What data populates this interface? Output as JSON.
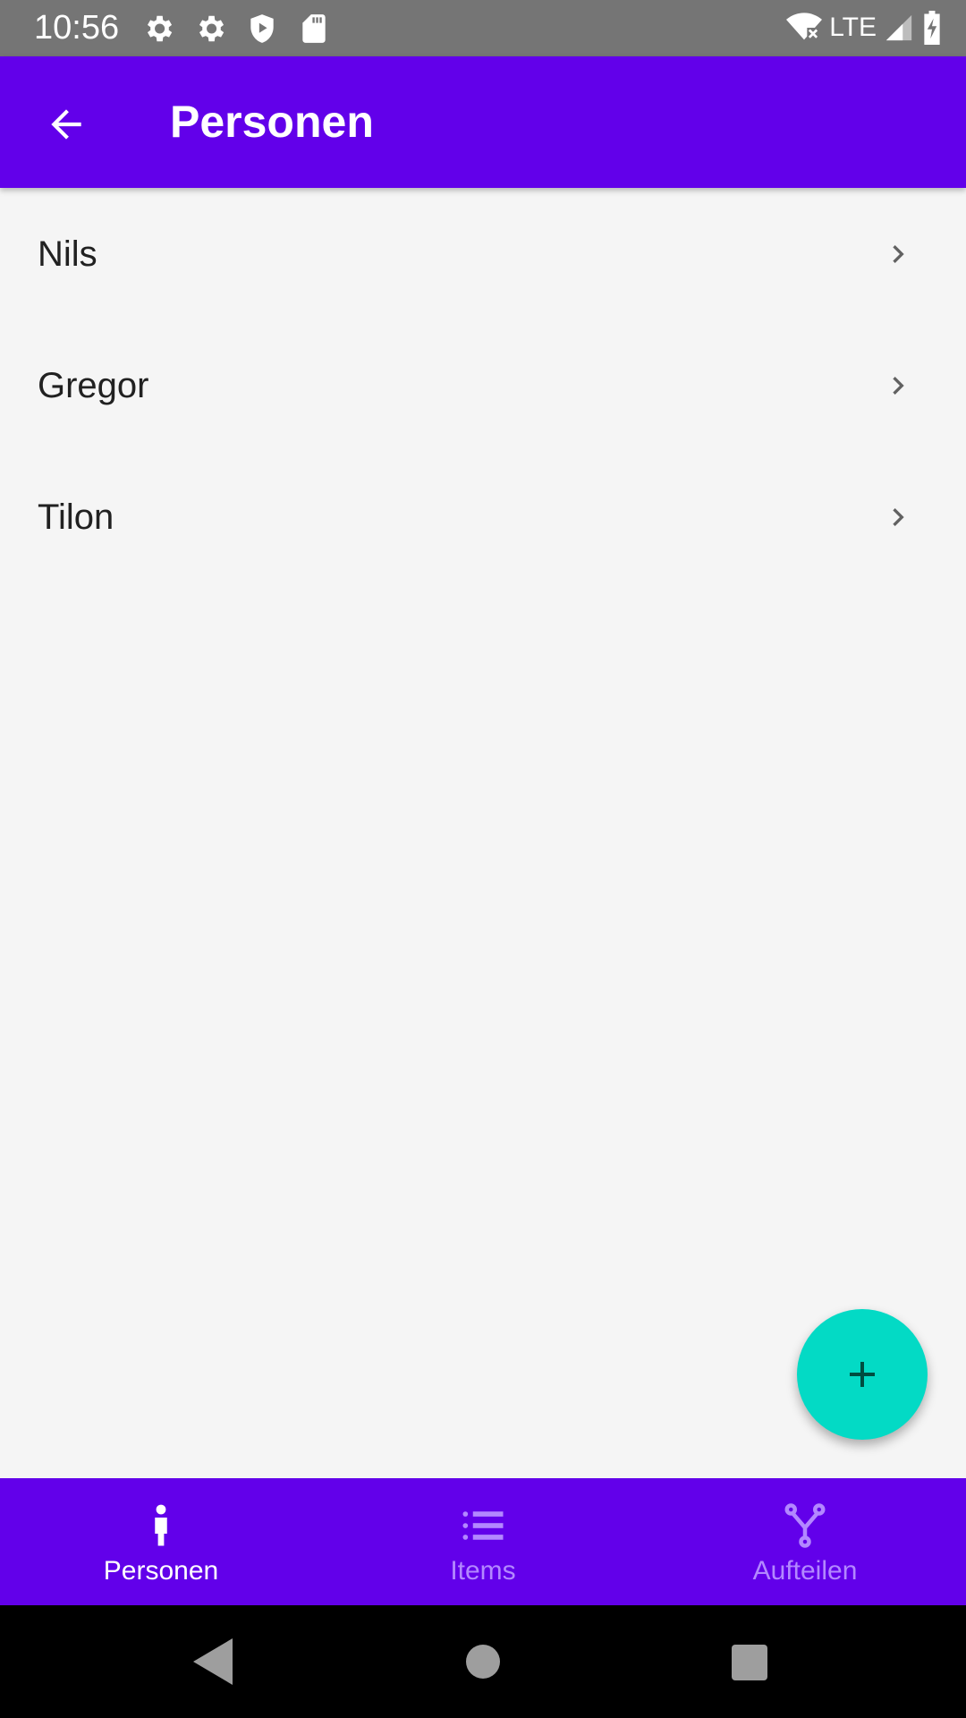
{
  "status_bar": {
    "time": "10:56",
    "network": "LTE",
    "left_icons": [
      "gear-icon",
      "gear-icon",
      "shield-play-icon",
      "sd-card-icon"
    ],
    "right_icons": [
      "wifi-off-icon",
      "signal-icon",
      "battery-charging-icon"
    ]
  },
  "app_bar": {
    "title": "Personen",
    "back_icon": "arrow-back-icon",
    "background": "#6200ea"
  },
  "persons": [
    {
      "name": "Nils"
    },
    {
      "name": "Gregor"
    },
    {
      "name": "Tilon"
    }
  ],
  "fab": {
    "icon": "plus-icon",
    "color": "#03dac5"
  },
  "bottom_nav": {
    "items": [
      {
        "label": "Personen",
        "icon": "person-icon",
        "active": true
      },
      {
        "label": "Items",
        "icon": "list-icon",
        "active": false
      },
      {
        "label": "Aufteilen",
        "icon": "split-icon",
        "active": false
      }
    ],
    "active_color": "#ffffff",
    "inactive_color": "#b388ff"
  },
  "system_nav": {
    "buttons": [
      "back-triangle-icon",
      "home-circle-icon",
      "recents-square-icon"
    ]
  }
}
